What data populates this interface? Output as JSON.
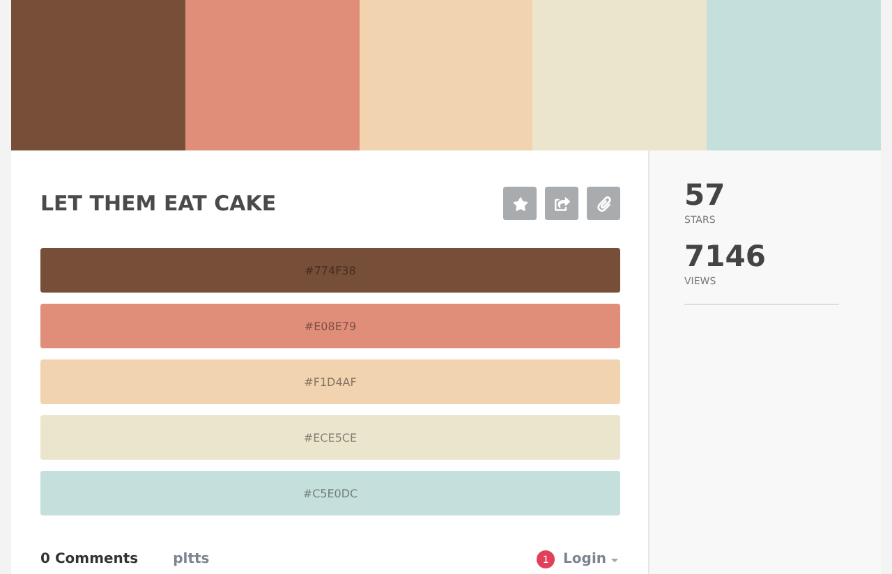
{
  "title": "LET THEM EAT CAKE",
  "swatches": [
    {
      "label": "#774F38",
      "color": "#774f38"
    },
    {
      "label": "#E08E79",
      "color": "#e08e79"
    },
    {
      "label": "#F1D4AF",
      "color": "#f1d4af"
    },
    {
      "label": "#ECE5CE",
      "color": "#ece5ce"
    },
    {
      "label": "#C5E0DC",
      "color": "#c5e0dc"
    }
  ],
  "actions": [
    {
      "kind": "star"
    },
    {
      "kind": "share"
    },
    {
      "kind": "attach"
    }
  ],
  "stats": [
    {
      "value": "57",
      "label": "STARS"
    },
    {
      "value": "7146",
      "label": "VIEWS"
    }
  ],
  "comments": {
    "count": "0 Comments",
    "site": "pltts",
    "badge": "1",
    "login": "Login"
  }
}
